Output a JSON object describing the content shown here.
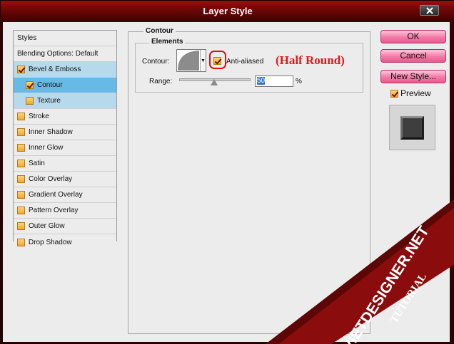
{
  "window": {
    "title": "Layer Style",
    "close_icon": "close-icon"
  },
  "styles_panel": {
    "header": "Styles",
    "blending": "Blending Options: Default",
    "items": [
      {
        "label": "Bevel & Emboss",
        "checked": true,
        "state": "selected"
      },
      {
        "label": "Contour",
        "checked": true,
        "state": "active",
        "indent": true
      },
      {
        "label": "Texture",
        "checked": false,
        "state": "selected",
        "indent": true
      },
      {
        "label": "Stroke",
        "checked": false
      },
      {
        "label": "Inner Shadow",
        "checked": false
      },
      {
        "label": "Inner Glow",
        "checked": false
      },
      {
        "label": "Satin",
        "checked": false
      },
      {
        "label": "Color Overlay",
        "checked": false
      },
      {
        "label": "Gradient Overlay",
        "checked": false
      },
      {
        "label": "Pattern Overlay",
        "checked": false
      },
      {
        "label": "Outer Glow",
        "checked": false
      },
      {
        "label": "Drop Shadow",
        "checked": false
      }
    ]
  },
  "contour": {
    "group_title": "Contour",
    "elements_title": "Elements",
    "contour_label": "Contour:",
    "anti_aliased_label": "Anti-aliased",
    "anti_aliased_checked": true,
    "annotation": "(Half Round)",
    "range_label": "Range:",
    "range_value": "50",
    "range_unit": "%",
    "range_fraction": 0.5
  },
  "buttons": {
    "ok": "OK",
    "cancel": "Cancel",
    "new_style": "New Style..."
  },
  "preview": {
    "label": "Preview",
    "checked": true
  },
  "watermark": {
    "site": "VIETDESIGNER.NET",
    "tag": "TUTORIAL"
  },
  "colors": {
    "accent": "#e01818",
    "button": "#f37aa6",
    "titlebar": "#6a0606"
  }
}
